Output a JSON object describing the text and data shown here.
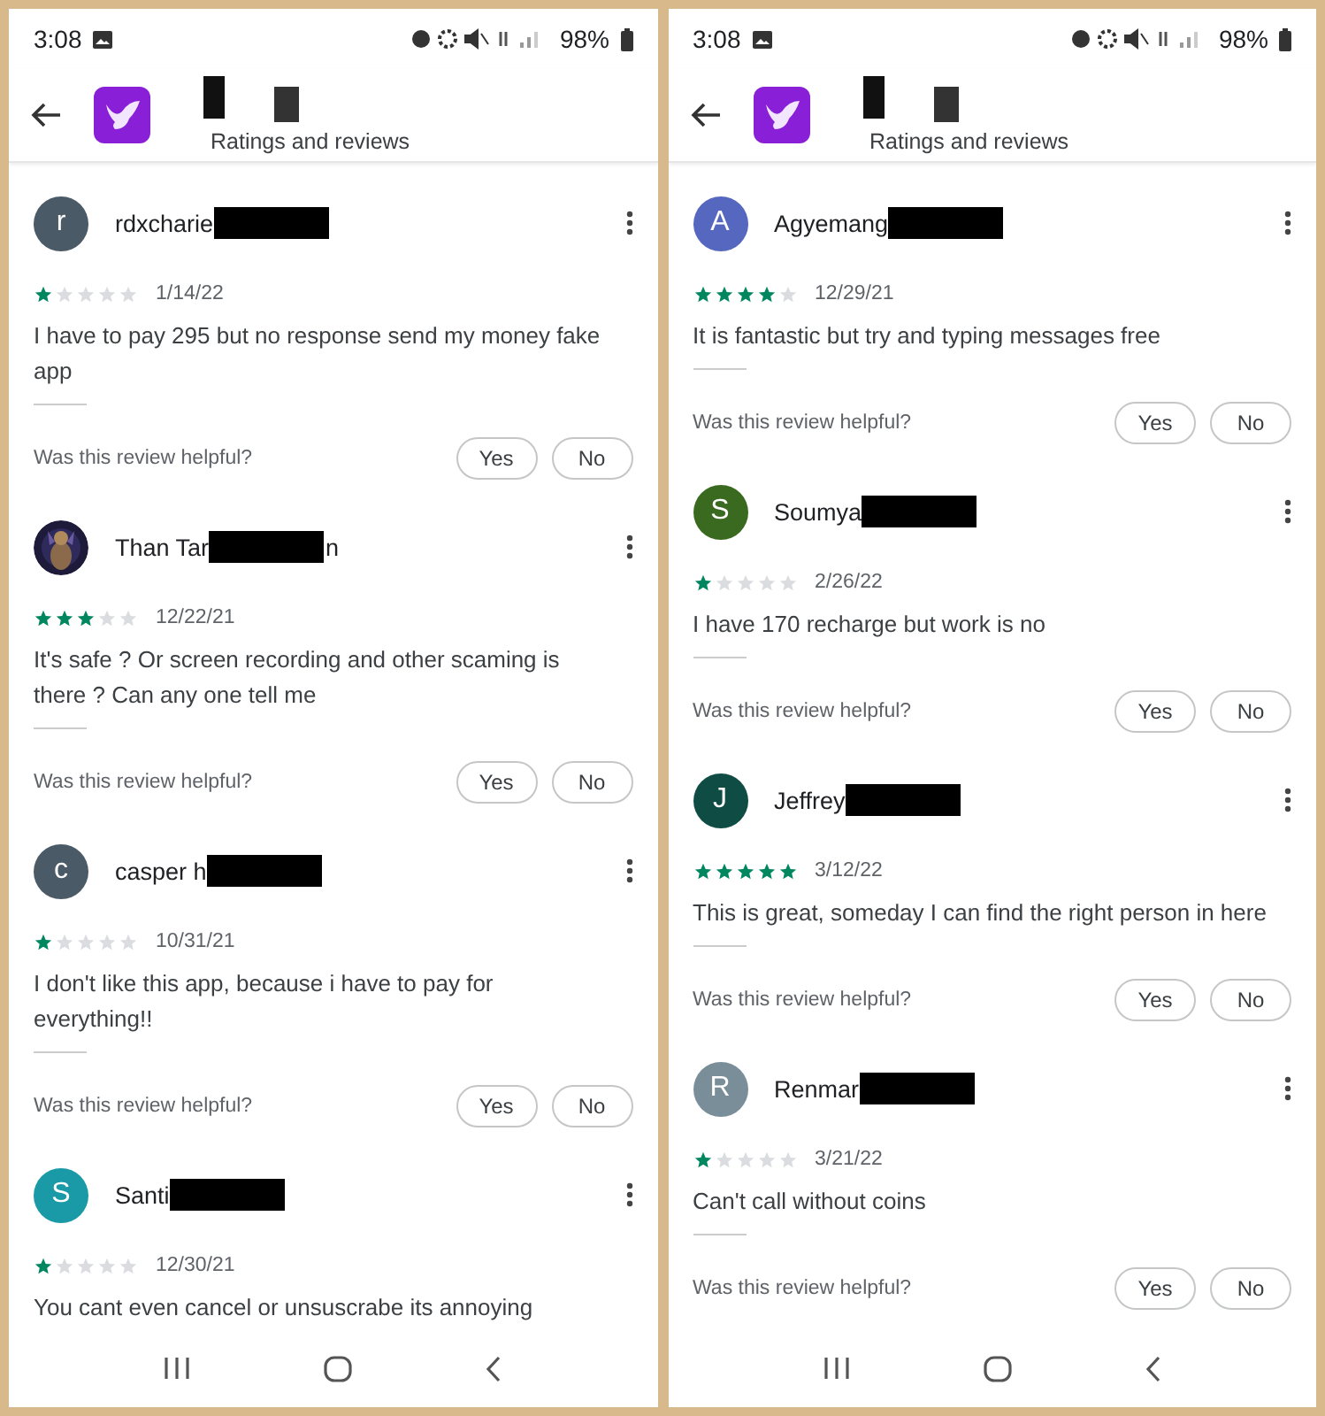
{
  "screens": [
    {
      "status_bar": {
        "time": "3:08",
        "battery": "98%"
      },
      "app_bar": {
        "title": "Ratings and reviews"
      },
      "reviews": [
        {
          "name": "rdxcharie",
          "avatar": {
            "kind": "letter",
            "letter": "r",
            "color": "#4a5a66"
          },
          "stars": 1,
          "date": "1/14/22",
          "text": "I have to pay 295 but no response send my money fake app",
          "helpful": {
            "question": "Was this review helpful?",
            "yes": "Yes",
            "no": "No"
          }
        },
        {
          "name": "Than Tar",
          "name_tail": "n",
          "stars": 3,
          "date": "12/22/21",
          "text": "It's safe ? Or screen recording and other scaming is there ? Can any one tell me",
          "helpful": {
            "question": "Was this review helpful?",
            "yes": "Yes",
            "no": "No"
          }
        },
        {
          "name": "casper h",
          "avatar": {
            "kind": "letter",
            "letter": "c",
            "color": "#4a5a66"
          },
          "stars": 1,
          "date": "10/31/21",
          "text": "I don't like this app, because i have to pay for everything!!",
          "helpful": {
            "question": "Was this review helpful?",
            "yes": "Yes",
            "no": "No"
          }
        },
        {
          "name": "Santi",
          "avatar": {
            "kind": "letter",
            "letter": "S",
            "color": "#1a9aa6"
          },
          "stars": 1,
          "date": "12/30/21",
          "text": "You cant even cancel or unsuscrabe its annoying"
        }
      ]
    },
    {
      "status_bar": {
        "time": "3:08",
        "battery": "98%"
      },
      "app_bar": {
        "title": "Ratings and reviews"
      },
      "reviews": [
        {
          "name": "Agyemang",
          "avatar": {
            "kind": "letter",
            "letter": "A",
            "color": "#5667c0"
          },
          "stars": 4,
          "date": "12/29/21",
          "text": "It is fantastic but try and typing messages free",
          "helpful": {
            "question": "Was this review helpful?",
            "yes": "Yes",
            "no": "No"
          }
        },
        {
          "name": "Soumya",
          "avatar": {
            "kind": "letter",
            "letter": "S",
            "color": "#3a6a1f"
          },
          "stars": 1,
          "date": "2/26/22",
          "text": "I have 170 recharge but work is no",
          "helpful": {
            "question": "Was this review helpful?",
            "yes": "Yes",
            "no": "No"
          }
        },
        {
          "name": "Jeffrey",
          "avatar": {
            "kind": "letter",
            "letter": "J",
            "color": "#0f4d44"
          },
          "stars": 5,
          "date": "3/12/22",
          "text": "This is great, someday I can find the right person in here",
          "helpful": {
            "question": "Was this review helpful?",
            "yes": "Yes",
            "no": "No"
          }
        },
        {
          "name": "Renmar",
          "avatar": {
            "kind": "letter",
            "letter": "R",
            "color": "#7a8e99"
          },
          "stars": 1,
          "date": "3/21/22",
          "text": "Can't call without coins",
          "helpful": {
            "question": "Was this review helpful?",
            "yes": "Yes",
            "no": "No"
          }
        }
      ]
    }
  ]
}
